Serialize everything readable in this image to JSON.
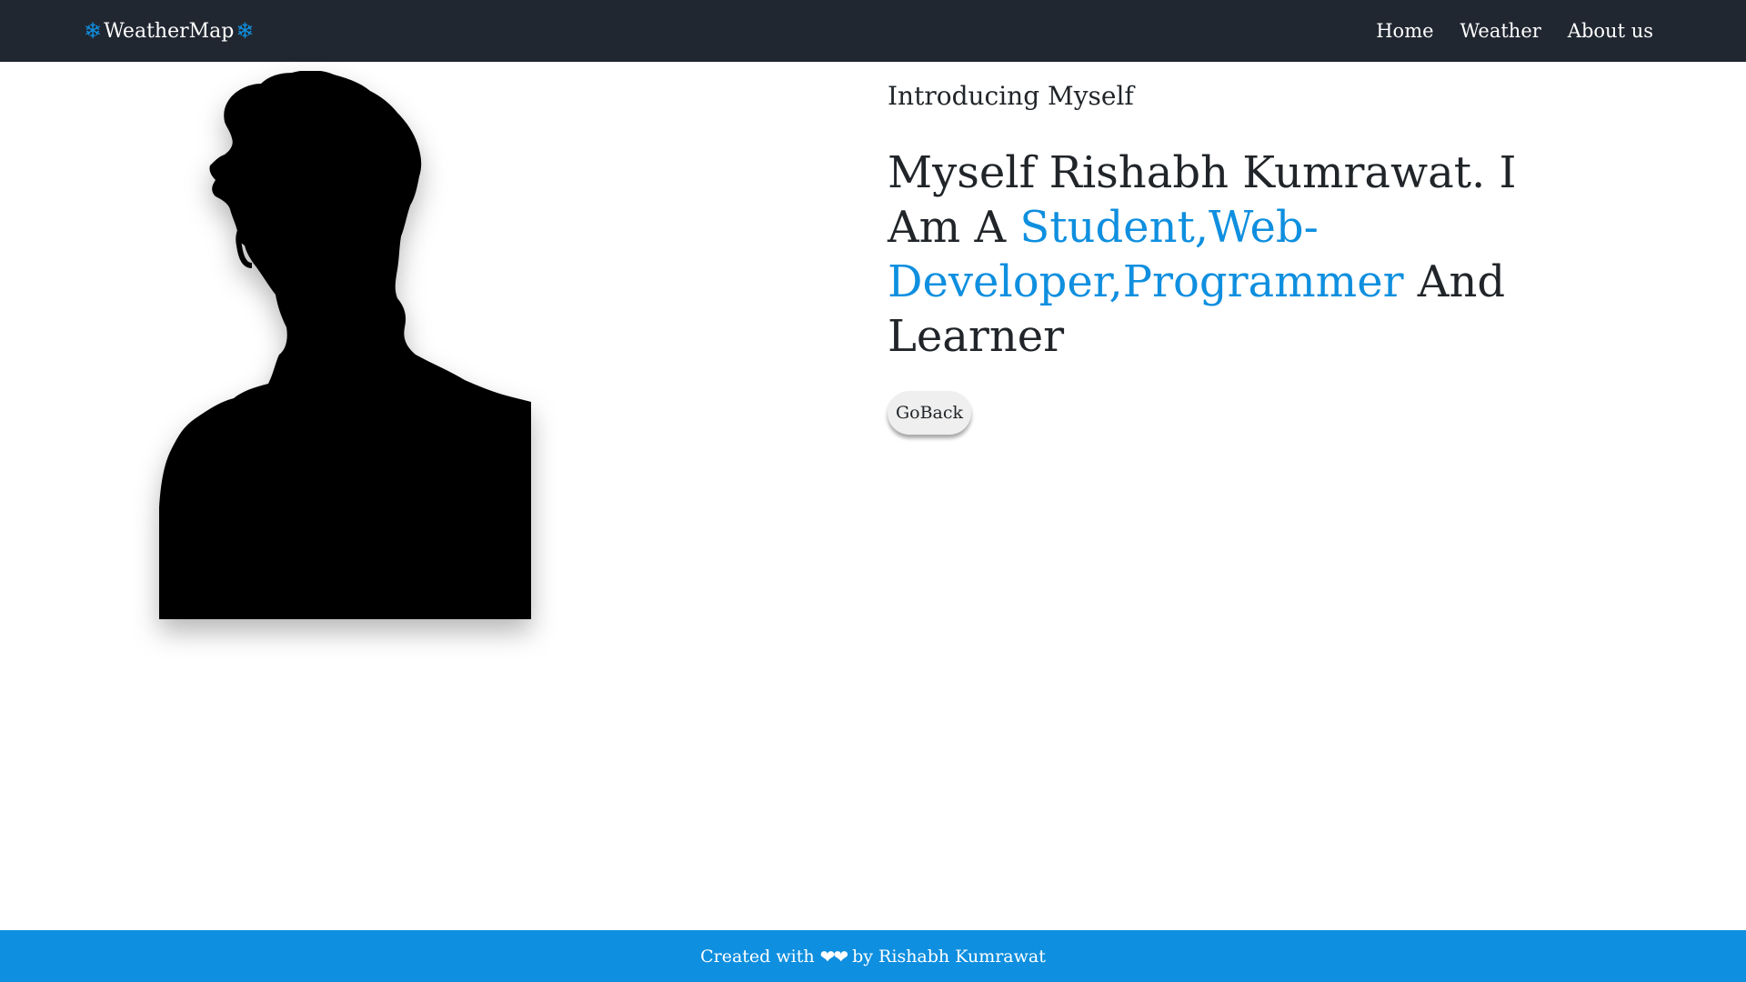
{
  "navbar": {
    "brand": "WeatherMap",
    "brand_icon": "snowflake-icon",
    "links": [
      "Home",
      "Weather",
      "About us"
    ]
  },
  "main": {
    "subtitle": "Introducing Myself",
    "title_before": "Myself Rishabh Kumrawat. I Am A ",
    "title_highlight": "Student,Web-Developer,Programmer",
    "title_after": " And Learner",
    "button": "GoBack",
    "image": "silhouette-portrait"
  },
  "footer": {
    "text_before": "Created with",
    "hearts": "❤❤",
    "text_after": "by Rishabh Kumrawat"
  },
  "colors": {
    "navbar_bg": "#212731",
    "accent": "#0f8fdf",
    "text": "#212529"
  }
}
